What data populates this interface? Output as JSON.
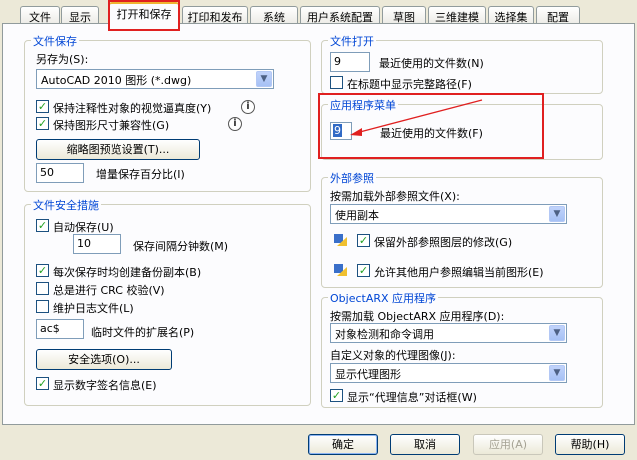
{
  "tabs": [
    "文件",
    "显示",
    "打开和保存",
    "打印和发布",
    "系统",
    "用户系统配置",
    "草图",
    "三维建模",
    "选择集",
    "配置"
  ],
  "file_save": {
    "title": "文件保存",
    "save_as_label": "另存为(S):",
    "save_as_value": "AutoCAD 2010 图形 (*.dwg)",
    "annotative_label": "保持注释性对象的视觉逼真度(Y)",
    "drawing_size_label": "保持图形尺寸兼容性(G)",
    "thumbnail_button": "缩略图预览设置(T)...",
    "incremental_value": "50",
    "incremental_label": "增量保存百分比(I)"
  },
  "file_safety": {
    "title": "文件安全措施",
    "autosave_label": "自动保存(U)",
    "autosave_minutes_value": "10",
    "autosave_minutes_label": "保存间隔分钟数(M)",
    "backup_label": "每次保存时均创建备份副本(B)",
    "crc_label": "总是进行 CRC 校验(V)",
    "log_label": "维护日志文件(L)",
    "temp_ext_value": "ac$",
    "temp_ext_label": "临时文件的扩展名(P)",
    "security_button": "安全选项(O)...",
    "signature_label": "显示数字签名信息(E)"
  },
  "file_open": {
    "title": "文件打开",
    "recent_value": "9",
    "recent_label": "最近使用的文件数(N)",
    "full_path_label": "在标题中显示完整路径(F)"
  },
  "app_menu": {
    "title": "应用程序菜单",
    "recent_value": "9",
    "recent_label": "最近使用的文件数(F)"
  },
  "xref": {
    "title": "外部参照",
    "demand_label": "按需加载外部参照文件(X):",
    "demand_value": "使用副本",
    "retain_label": "保留外部参照图层的修改(G)",
    "allow_label": "允许其他用户参照编辑当前图形(E)"
  },
  "objectarx": {
    "title": "ObjectARX 应用程序",
    "demand_label": "按需加载 ObjectARX 应用程序(D):",
    "demand_value": "对象检测和命令调用",
    "proxy_label": "自定义对象的代理图像(J):",
    "proxy_value": "显示代理图形",
    "proxy_dialog_label": "显示“代理信息”对话框(W)"
  },
  "buttons": {
    "ok": "确定",
    "cancel": "取消",
    "apply": "应用(A)",
    "help": "帮助(H)"
  },
  "colors": {
    "annotation_red": "#e02020",
    "group_title": "#0046d5"
  }
}
